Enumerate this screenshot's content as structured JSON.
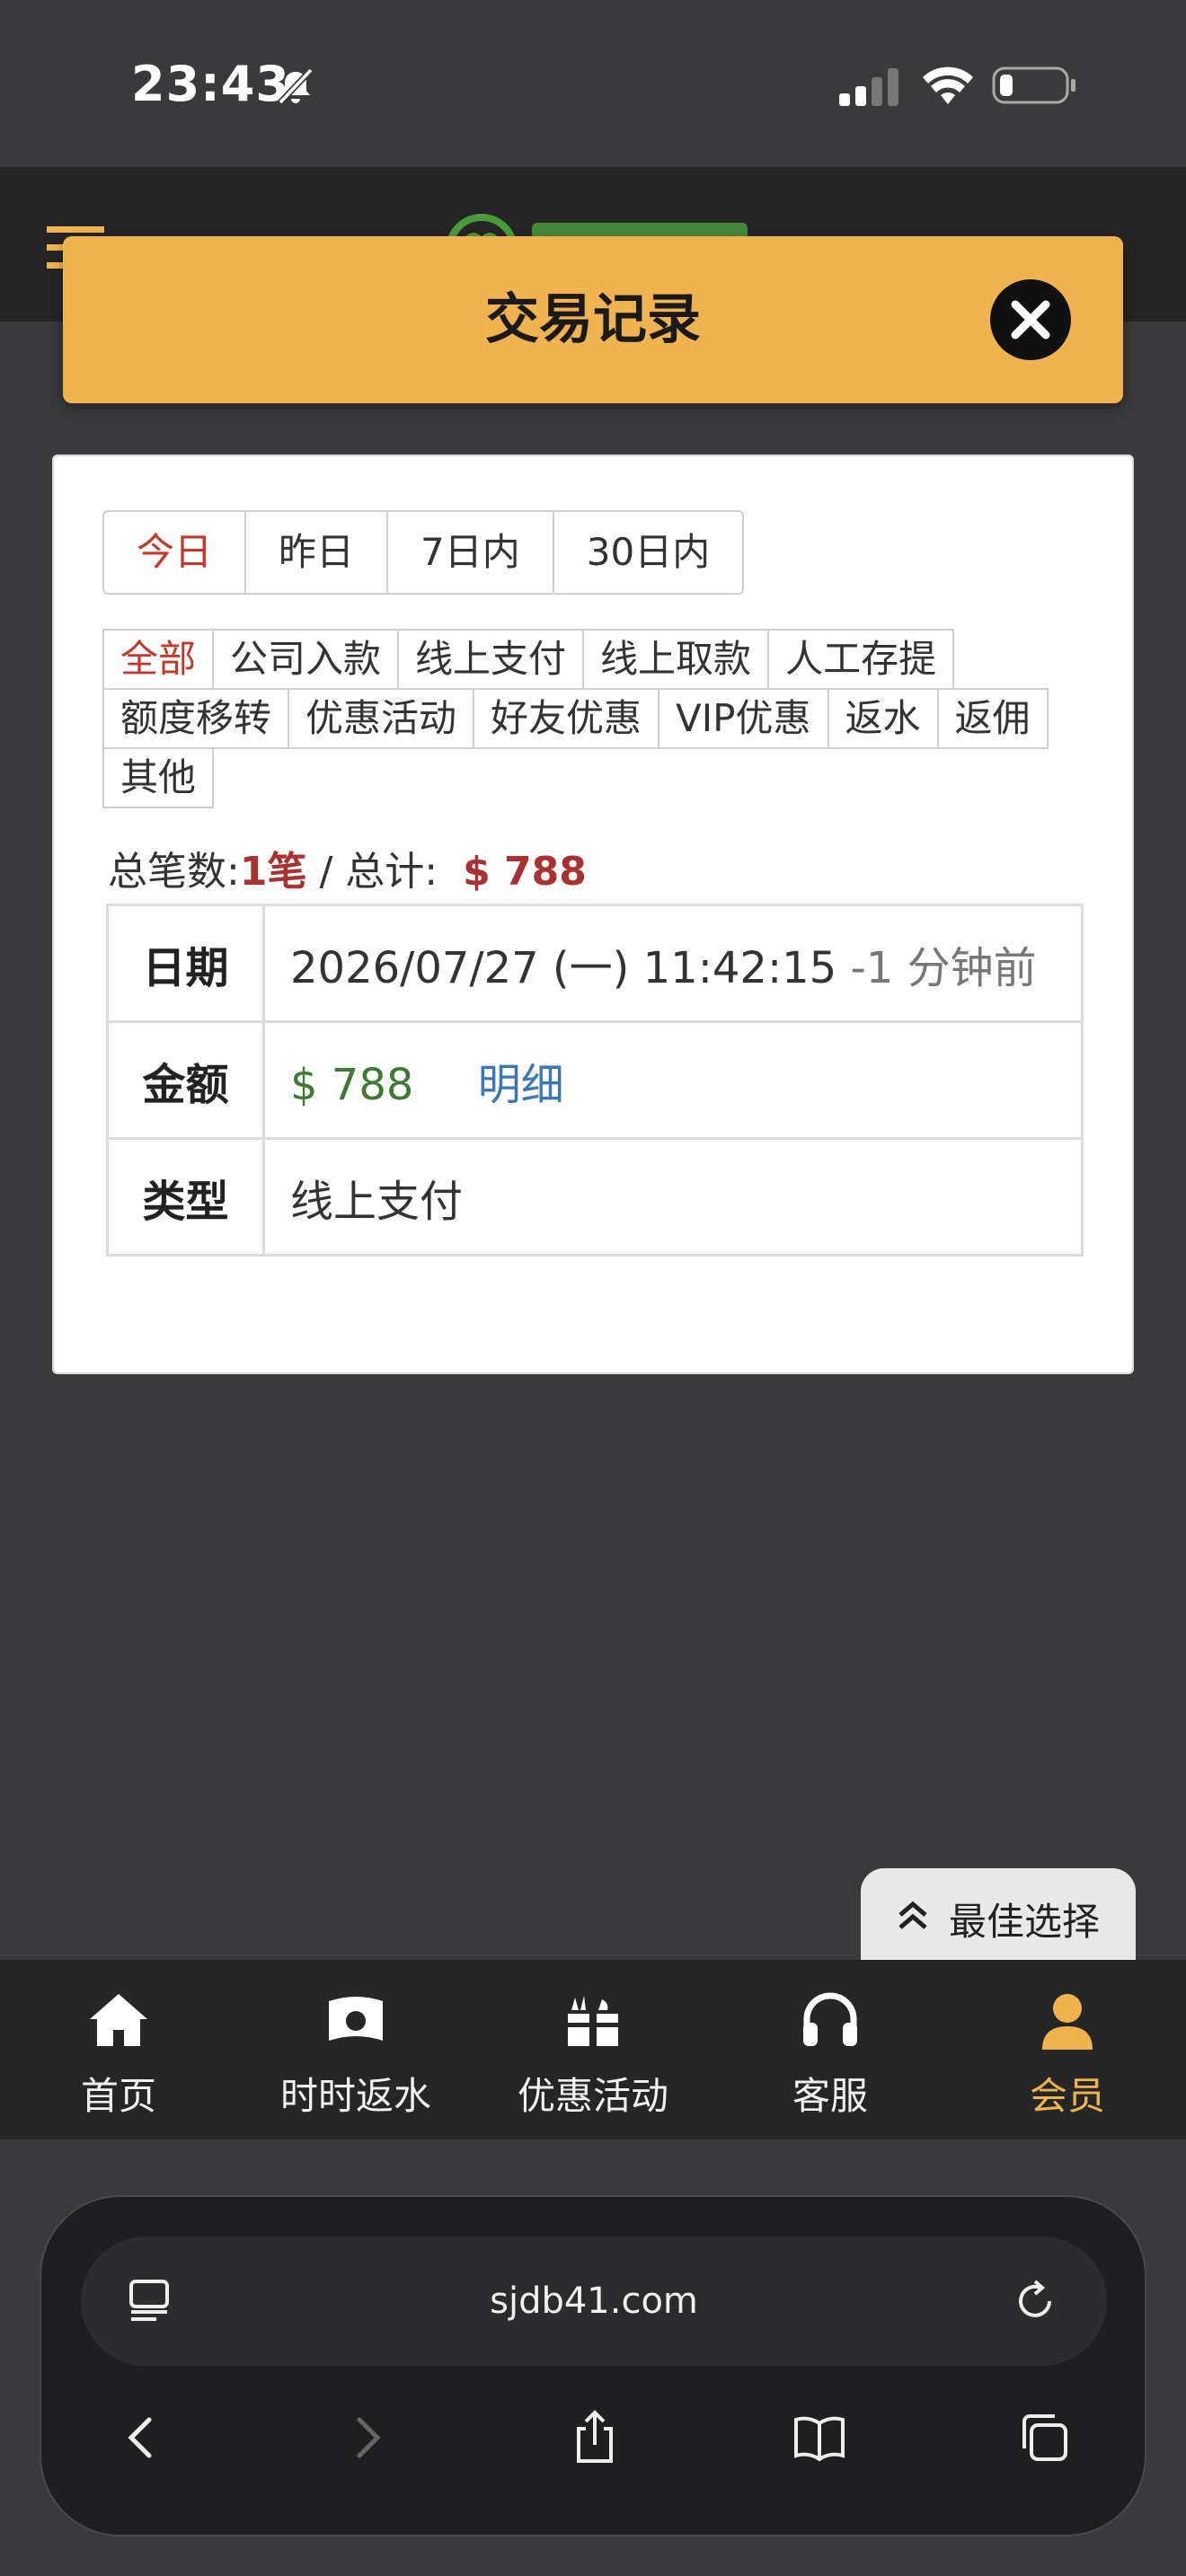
{
  "status_bar": {
    "time": "23:43"
  },
  "modal": {
    "title": "交易记录",
    "date_tabs": [
      "今日",
      "昨日",
      "7日内",
      "30日内"
    ],
    "active_date_tab": "今日",
    "type_filters": [
      "全部",
      "公司入款",
      "线上支付",
      "线上取款",
      "人工存提",
      "额度移转",
      "优惠活动",
      "好友优惠",
      "VIP优惠",
      "返水",
      "返佣",
      "其他"
    ],
    "active_type_filter": "全部",
    "summary": {
      "count_label": "总笔数:",
      "count_value": "1笔",
      "separator": " / ",
      "total_label": "总计:",
      "total_value": "$ 788"
    },
    "record": {
      "date_label": "日期",
      "date_value": "2026/07/27 (一) 11:42:15",
      "date_ago": "-1 分钟前",
      "amount_label": "金额",
      "amount_value": "$ 788",
      "detail_link": "明细",
      "type_label": "类型",
      "type_value": "线上支付"
    }
  },
  "best_choice": {
    "label": "最佳选择"
  },
  "bottom_nav": {
    "items": [
      {
        "label": "首页",
        "icon": "home-icon"
      },
      {
        "label": "时时返水",
        "icon": "banknote-icon"
      },
      {
        "label": "优惠活动",
        "icon": "gift-icon"
      },
      {
        "label": "客服",
        "icon": "headset-icon"
      },
      {
        "label": "会员",
        "icon": "user-icon"
      }
    ],
    "active": "会员"
  },
  "browser": {
    "url": "sjdb41.com"
  },
  "colors": {
    "accent": "#f1b34f",
    "active_red": "#c0392b",
    "amount_green": "#3f7a35",
    "link_blue": "#3b78b3"
  }
}
